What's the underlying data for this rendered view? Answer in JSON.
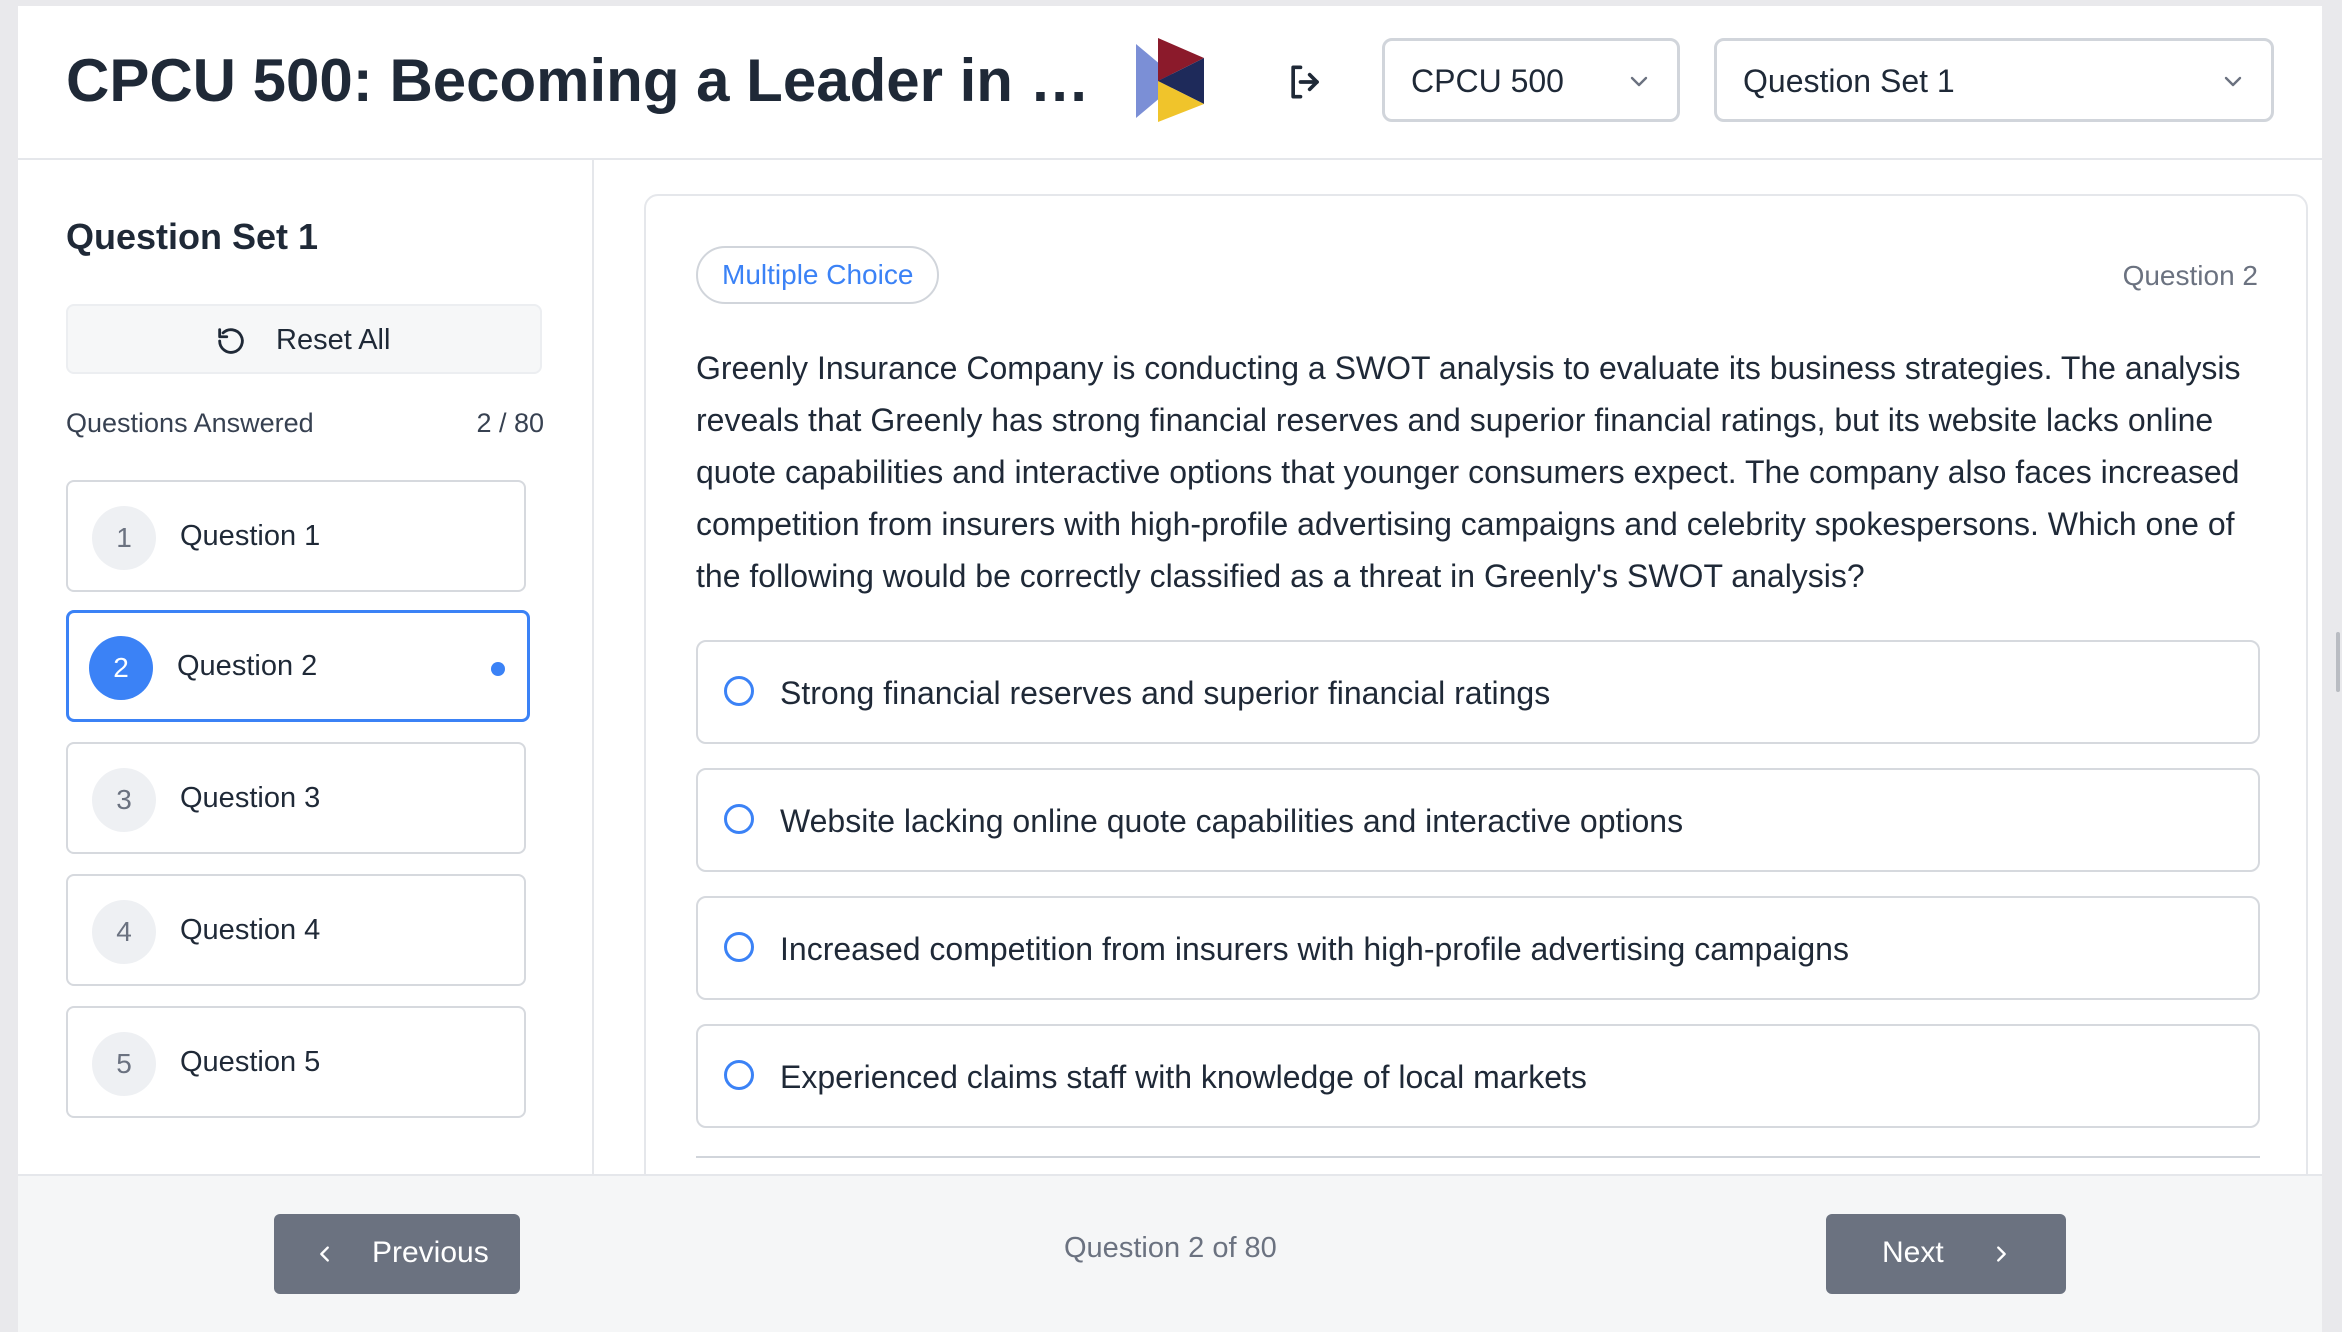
{
  "header": {
    "title": "CPCU 500: Becoming a Leader in Ris...",
    "logo_icon": "play-triangle-logo",
    "exit_icon": "logout-icon",
    "course_select": {
      "value": "CPCU 500"
    },
    "set_select": {
      "value": "Question Set 1"
    }
  },
  "sidebar": {
    "title": "Question Set 1",
    "reset_label": "Reset All",
    "answered_label": "Questions Answered",
    "answered_count": "2 / 80",
    "questions": [
      {
        "num": "1",
        "label": "Question 1"
      },
      {
        "num": "2",
        "label": "Question 2"
      },
      {
        "num": "3",
        "label": "Question 3"
      },
      {
        "num": "4",
        "label": "Question 4"
      },
      {
        "num": "5",
        "label": "Question 5"
      }
    ]
  },
  "question": {
    "type": "Multiple Choice",
    "number_label": "Question 2",
    "text": "Greenly Insurance Company is conducting a SWOT analysis to evaluate its business strategies. The analysis reveals that Greenly has strong financial reserves and superior financial ratings, but its website lacks online quote capabilities and interactive options that younger consumers expect. The company also faces increased competition from insurers with high-profile advertising campaigns and celebrity spokespersons. Which one of the following would be correctly classified as a threat in Greenly's SWOT analysis?",
    "options": [
      "Strong financial reserves and superior financial ratings",
      "Website lacking online quote capabilities and interactive options",
      "Increased competition from insurers with high-profile advertising campaigns",
      "Experienced claims staff with knowledge of local markets"
    ]
  },
  "footer": {
    "prev_label": "Previous",
    "next_label": "Next",
    "progress": "Question 2 of 80"
  },
  "colors": {
    "accent": "#3b82f6",
    "nav_button": "#6b7280",
    "logo_dark_red": "#8b1a2b",
    "logo_yellow": "#f0c42b",
    "logo_blue": "#7b8fd6"
  }
}
